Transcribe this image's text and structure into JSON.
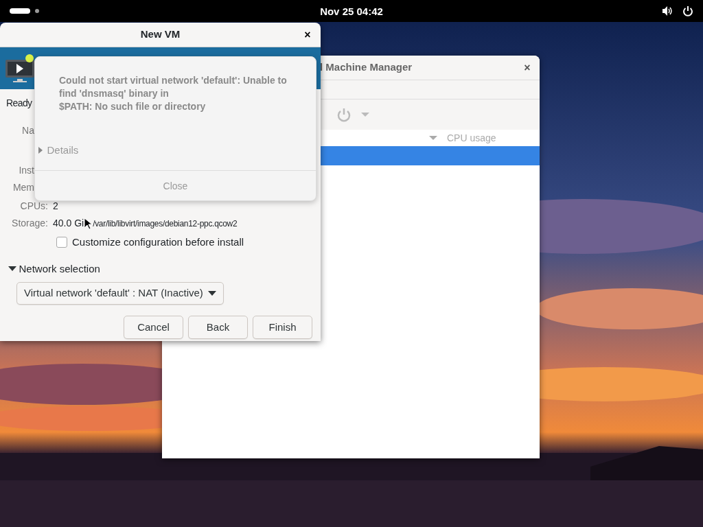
{
  "top_bar": {
    "clock": "Nov 25  04:42"
  },
  "manager_window": {
    "title": "l Machine Manager",
    "close": "×",
    "column_header": "CPU usage",
    "rows": [
      {
        "selected": true
      }
    ]
  },
  "new_vm_window": {
    "title": "New VM",
    "close": "×",
    "status": "Ready",
    "fields": [
      {
        "kind": "covered",
        "label": "Na"
      },
      {
        "kind": "covered",
        "label": "Inst"
      },
      {
        "kind": "covered",
        "label": "Mem"
      },
      {
        "kind": "plain",
        "label": "CPUs:",
        "value": "2"
      },
      {
        "kind": "storage",
        "label": "Storage:",
        "value": "40.0 Gi",
        "path": "/var/lib/libvirt/images/debian12-ppc.qcow2"
      }
    ],
    "customize": {
      "label": "Customize configuration before install",
      "checked": false
    },
    "network": {
      "label": "Network selection",
      "expanded": true,
      "dropdown": "Virtual network 'default' : NAT (Inactive)"
    },
    "buttons": [
      "Cancel",
      "Back",
      "Finish"
    ]
  },
  "error_dialog": {
    "message_lines": [
      "Could not start virtual network 'default': Unable to",
      "find 'dnsmasq' binary in",
      "$PATH: No such file or directory"
    ],
    "details": {
      "label": "Details",
      "expanded": false
    },
    "button": "Close"
  }
}
